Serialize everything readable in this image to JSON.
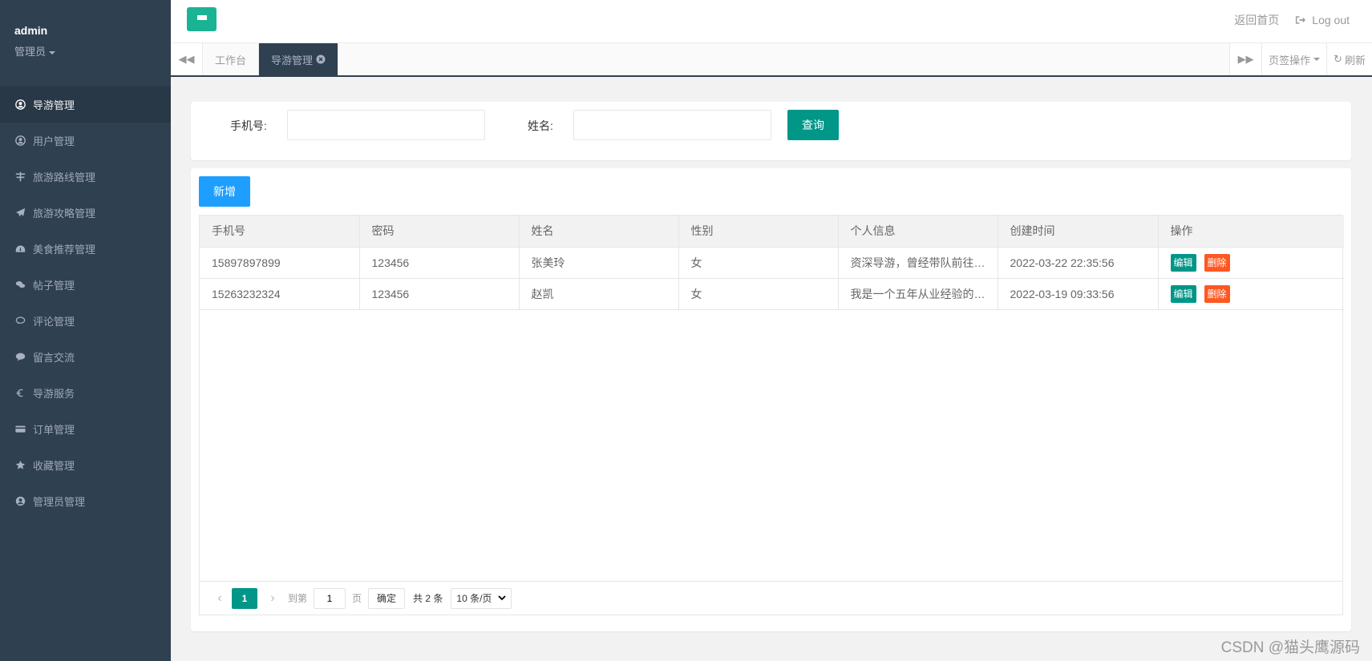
{
  "sidebar": {
    "username": "admin",
    "role": "管理员",
    "items": [
      {
        "label": "导游管理",
        "icon": "user-circle-icon",
        "active": true
      },
      {
        "label": "用户管理",
        "icon": "user-circle-icon"
      },
      {
        "label": "旅游路线管理",
        "icon": "road-icon"
      },
      {
        "label": "旅游攻略管理",
        "icon": "paper-plane-icon"
      },
      {
        "label": "美食推荐管理",
        "icon": "dashboard-icon"
      },
      {
        "label": "帖子管理",
        "icon": "comments-icon"
      },
      {
        "label": "评论管理",
        "icon": "comment-icon"
      },
      {
        "label": "留言交流",
        "icon": "commenting-icon"
      },
      {
        "label": "导游服务",
        "icon": "euro-icon"
      },
      {
        "label": "订单管理",
        "icon": "credit-card-icon"
      },
      {
        "label": "收藏管理",
        "icon": "star-icon"
      },
      {
        "label": "管理员管理",
        "icon": "user-circle-icon"
      }
    ]
  },
  "header": {
    "home_link": "返回首页",
    "logout": "Log out"
  },
  "tabs": {
    "items": [
      {
        "label": "工作台"
      },
      {
        "label": "导游管理",
        "active": true
      }
    ],
    "tab_ops": "页签操作",
    "refresh": "刷新"
  },
  "search": {
    "phone_label": "手机号:",
    "name_label": "姓名:",
    "phone_value": "",
    "name_value": "",
    "query_button": "查询"
  },
  "table": {
    "add_button": "新增",
    "columns": [
      "手机号",
      "密码",
      "姓名",
      "性别",
      "个人信息",
      "创建时间",
      "操作"
    ],
    "rows": [
      {
        "phone": "15897897899",
        "password": "123456",
        "name": "张美玲",
        "gender": "女",
        "info": "资深导游，曾经带队前往…",
        "created": "2022-03-22 22:35:56"
      },
      {
        "phone": "15263232324",
        "password": "123456",
        "name": "赵凯",
        "gender": "女",
        "info": "我是一个五年从业经验的…",
        "created": "2022-03-19 09:33:56"
      }
    ],
    "edit_label": "编辑",
    "delete_label": "删除"
  },
  "pager": {
    "current": "1",
    "goto_label": "到第",
    "goto_value": "1",
    "page_unit": "页",
    "confirm": "确定",
    "total": "共 2 条",
    "page_size": "10 条/页"
  },
  "watermark": "CSDN @猫头鹰源码",
  "colors": {
    "sidebar_bg": "#2f4050",
    "primary": "#009688",
    "add_blue": "#1e9fff",
    "danger": "#ff5722",
    "menu_btn": "#1ab394"
  }
}
